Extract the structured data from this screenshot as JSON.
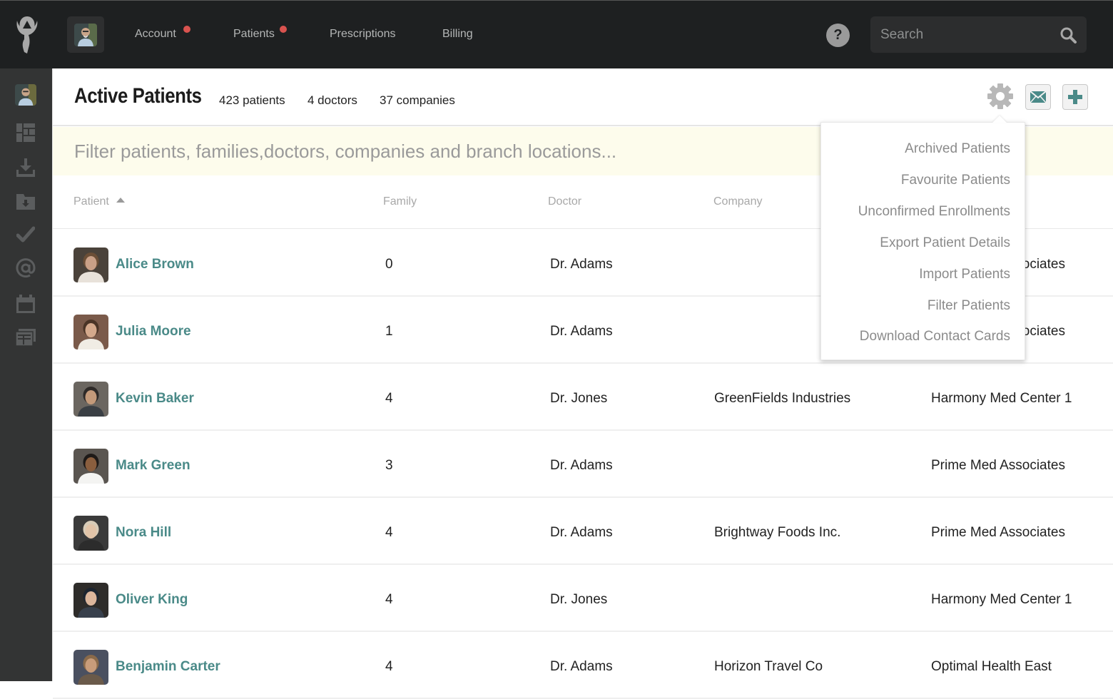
{
  "topbar": {
    "nav": [
      {
        "label": "Account",
        "has_notification": true
      },
      {
        "label": "Patients",
        "has_notification": true
      },
      {
        "label": "Prescriptions",
        "has_notification": false
      },
      {
        "label": "Billing",
        "has_notification": false
      }
    ],
    "help_label": "?",
    "search_placeholder": "Search",
    "notification_color": "#d9534f"
  },
  "sidebar": {
    "items": [
      {
        "icon": "user-avatar"
      },
      {
        "icon": "dashboard-icon"
      },
      {
        "icon": "download-icon"
      },
      {
        "icon": "folder-download-icon"
      },
      {
        "icon": "checkmark-icon"
      },
      {
        "icon": "at-icon"
      },
      {
        "icon": "calendar-icon"
      },
      {
        "icon": "cards-icon"
      }
    ]
  },
  "header": {
    "title": "Active Patients",
    "stats": [
      "423 patients",
      "4 doctors",
      "37 companies"
    ]
  },
  "filter": {
    "placeholder": "Filter patients, families,doctors, companies and branch locations..."
  },
  "table": {
    "columns": [
      "Patient",
      "Family",
      "Doctor",
      "Company"
    ],
    "sort_column": "Patient",
    "sort_direction": "ascending",
    "rows": [
      {
        "name": "Alice Brown",
        "family": "0",
        "doctor": "Dr. Adams",
        "company": "",
        "branch": "Prime Med Associates"
      },
      {
        "name": "Julia Moore",
        "family": "1",
        "doctor": "Dr. Adams",
        "company": "",
        "branch": "Prime Med Associates"
      },
      {
        "name": "Kevin Baker",
        "family": "4",
        "doctor": "Dr. Jones",
        "company": "GreenFields Industries",
        "branch": "Harmony Med Center 1"
      },
      {
        "name": "Mark Green",
        "family": "3",
        "doctor": "Dr. Adams",
        "company": "",
        "branch": "Prime Med Associates"
      },
      {
        "name": "Nora Hill",
        "family": "4",
        "doctor": "Dr. Adams",
        "company": "Brightway Foods Inc.",
        "branch": "Prime Med Associates"
      },
      {
        "name": "Oliver King",
        "family": "4",
        "doctor": "Dr. Jones",
        "company": "",
        "branch": "Harmony Med Center 1"
      },
      {
        "name": "Benjamin Carter",
        "family": "4",
        "doctor": "Dr. Adams",
        "company": "Horizon Travel Co",
        "branch": "Optimal Health East"
      }
    ]
  },
  "settings_menu": {
    "items": [
      "Archived Patients",
      "Favourite Patients",
      "Unconfirmed Enrollments",
      "Export Patient Details",
      "Import Patients",
      "Filter Patients",
      "Download Contact Cards"
    ]
  },
  "colors": {
    "accent": "#4a8a88",
    "topbar_bg": "#1e2021",
    "sidebar_bg": "#333434",
    "filter_bg": "#fdfcec"
  }
}
